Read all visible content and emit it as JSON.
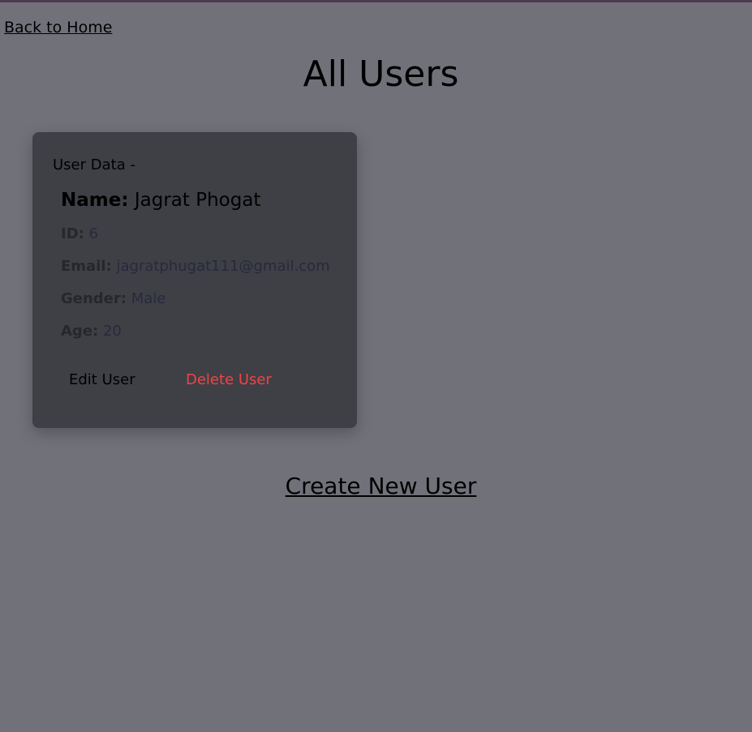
{
  "nav": {
    "back_label": "Back to Home"
  },
  "page": {
    "title": "All Users",
    "create_label": "Create New User"
  },
  "users": [
    {
      "section_label": "User Data -",
      "name_key": "Name:",
      "name_value": "Jagrat Phogat",
      "id_key": "ID:",
      "id_value": "6",
      "email_key": "Email:",
      "email_value": "jagratphugat111@gmail.com",
      "gender_key": "Gender:",
      "gender_value": "Male",
      "age_key": "Age:",
      "age_value": "20",
      "edit_label": "Edit User",
      "delete_label": "Delete User"
    }
  ],
  "colors": {
    "background": "#71717a",
    "card": "#3f3f46",
    "delete": "#ef4444",
    "top_border": "#4d3b4f"
  }
}
